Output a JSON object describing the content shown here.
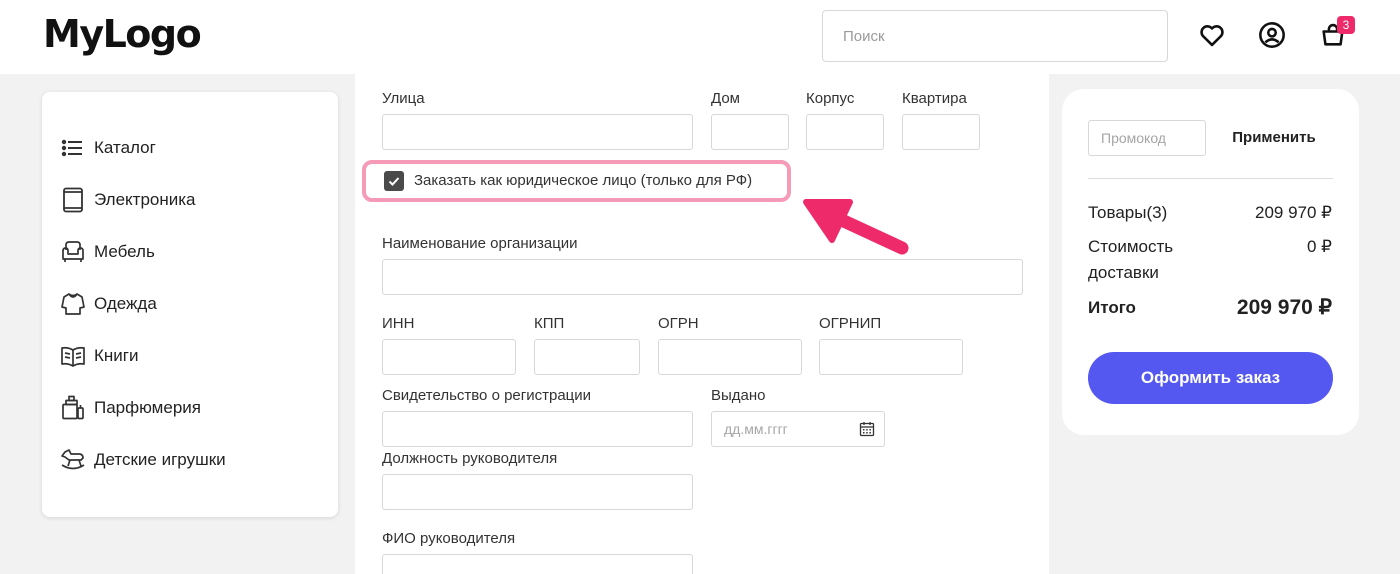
{
  "header": {
    "logo": "MyLogo",
    "search_placeholder": "Поиск",
    "cart_count": "3",
    "icons": [
      "heart-icon",
      "user-icon",
      "cart-icon"
    ]
  },
  "sidebar": {
    "items": [
      {
        "label": "Каталог",
        "icon": "list-icon"
      },
      {
        "label": "Электроника",
        "icon": "tablet-icon"
      },
      {
        "label": "Мебель",
        "icon": "armchair-icon"
      },
      {
        "label": "Одежда",
        "icon": "sweater-icon"
      },
      {
        "label": "Книги",
        "icon": "book-icon"
      },
      {
        "label": "Парфюмерия",
        "icon": "perfume-icon"
      },
      {
        "label": "Детские игрушки",
        "icon": "rocking-horse-icon"
      }
    ]
  },
  "form": {
    "street_label": "Улица",
    "house_label": "Дом",
    "building_label": "Корпус",
    "apartment_label": "Квартира",
    "legal_entity_label": "Заказать как юридическое лицо (только для РФ)",
    "legal_entity_checked": true,
    "org_name_label": "Наименование организации",
    "inn_label": "ИНН",
    "kpp_label": "КПП",
    "ogrn_label": "ОГРН",
    "ogrnip_label": "ОГРНИП",
    "certificate_label": "Свидетельство о регистрации",
    "issued_label": "Выдано",
    "issued_placeholder": "дд.мм.гггг",
    "director_position_label": "Должность руководителя",
    "director_name_label": "ФИО руководителя"
  },
  "summary": {
    "promo_placeholder": "Промокод",
    "apply_label": "Применить",
    "goods_label": "Товары(3)",
    "goods_value": "209 970 ₽",
    "delivery_label_1": "Стоимость",
    "delivery_label_2": "доставки",
    "delivery_value": "0 ₽",
    "total_label": "Итого",
    "total_value": "209 970 ₽",
    "order_button": "Оформить заказ"
  },
  "colors": {
    "accent": "#5558f0",
    "badge": "#ee2a6b",
    "highlight": "#f59ab7",
    "arrow": "#ee2a6b"
  }
}
